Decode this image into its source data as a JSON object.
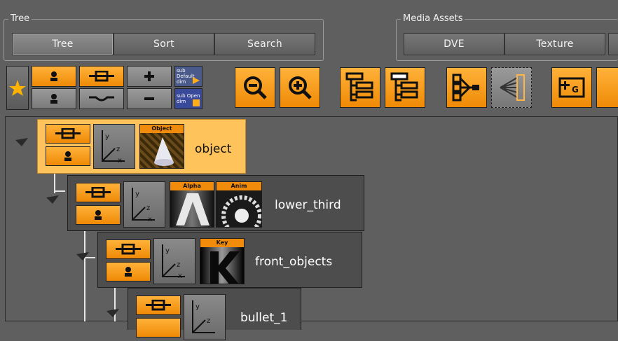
{
  "tree_group": {
    "title": "Tree",
    "tabs": [
      {
        "label": "Tree",
        "active": true
      },
      {
        "label": "Sort",
        "active": false
      },
      {
        "label": "Search",
        "active": false
      }
    ]
  },
  "media_group": {
    "title": "Media Assets",
    "tabs": [
      {
        "label": "DVE"
      },
      {
        "label": "Texture"
      }
    ]
  },
  "toolbar": {
    "sub_default_label": "sub Default dim",
    "sub_open_label": "sub Open dim"
  },
  "nodes": [
    {
      "name": "object",
      "selected": true,
      "thumbs": [
        {
          "caption": "Object",
          "kind": "object"
        }
      ]
    },
    {
      "name": "lower_third",
      "selected": false,
      "thumbs": [
        {
          "caption": "Alpha",
          "kind": "alpha"
        },
        {
          "caption": "Anim",
          "kind": "anim"
        }
      ]
    },
    {
      "name": "front_objects",
      "selected": false,
      "thumbs": [
        {
          "caption": "Key",
          "kind": "key"
        }
      ]
    },
    {
      "name": "bullet_1",
      "selected": false,
      "thumbs": []
    }
  ],
  "axis_labels": {
    "y": "y",
    "z": "z",
    "x": "x"
  },
  "colors": {
    "accent_orange": "#f08b0c",
    "selected_node": "#ffc35c",
    "panel_bg": "#5f5f5f",
    "node_bg": "#4d4d4d"
  }
}
